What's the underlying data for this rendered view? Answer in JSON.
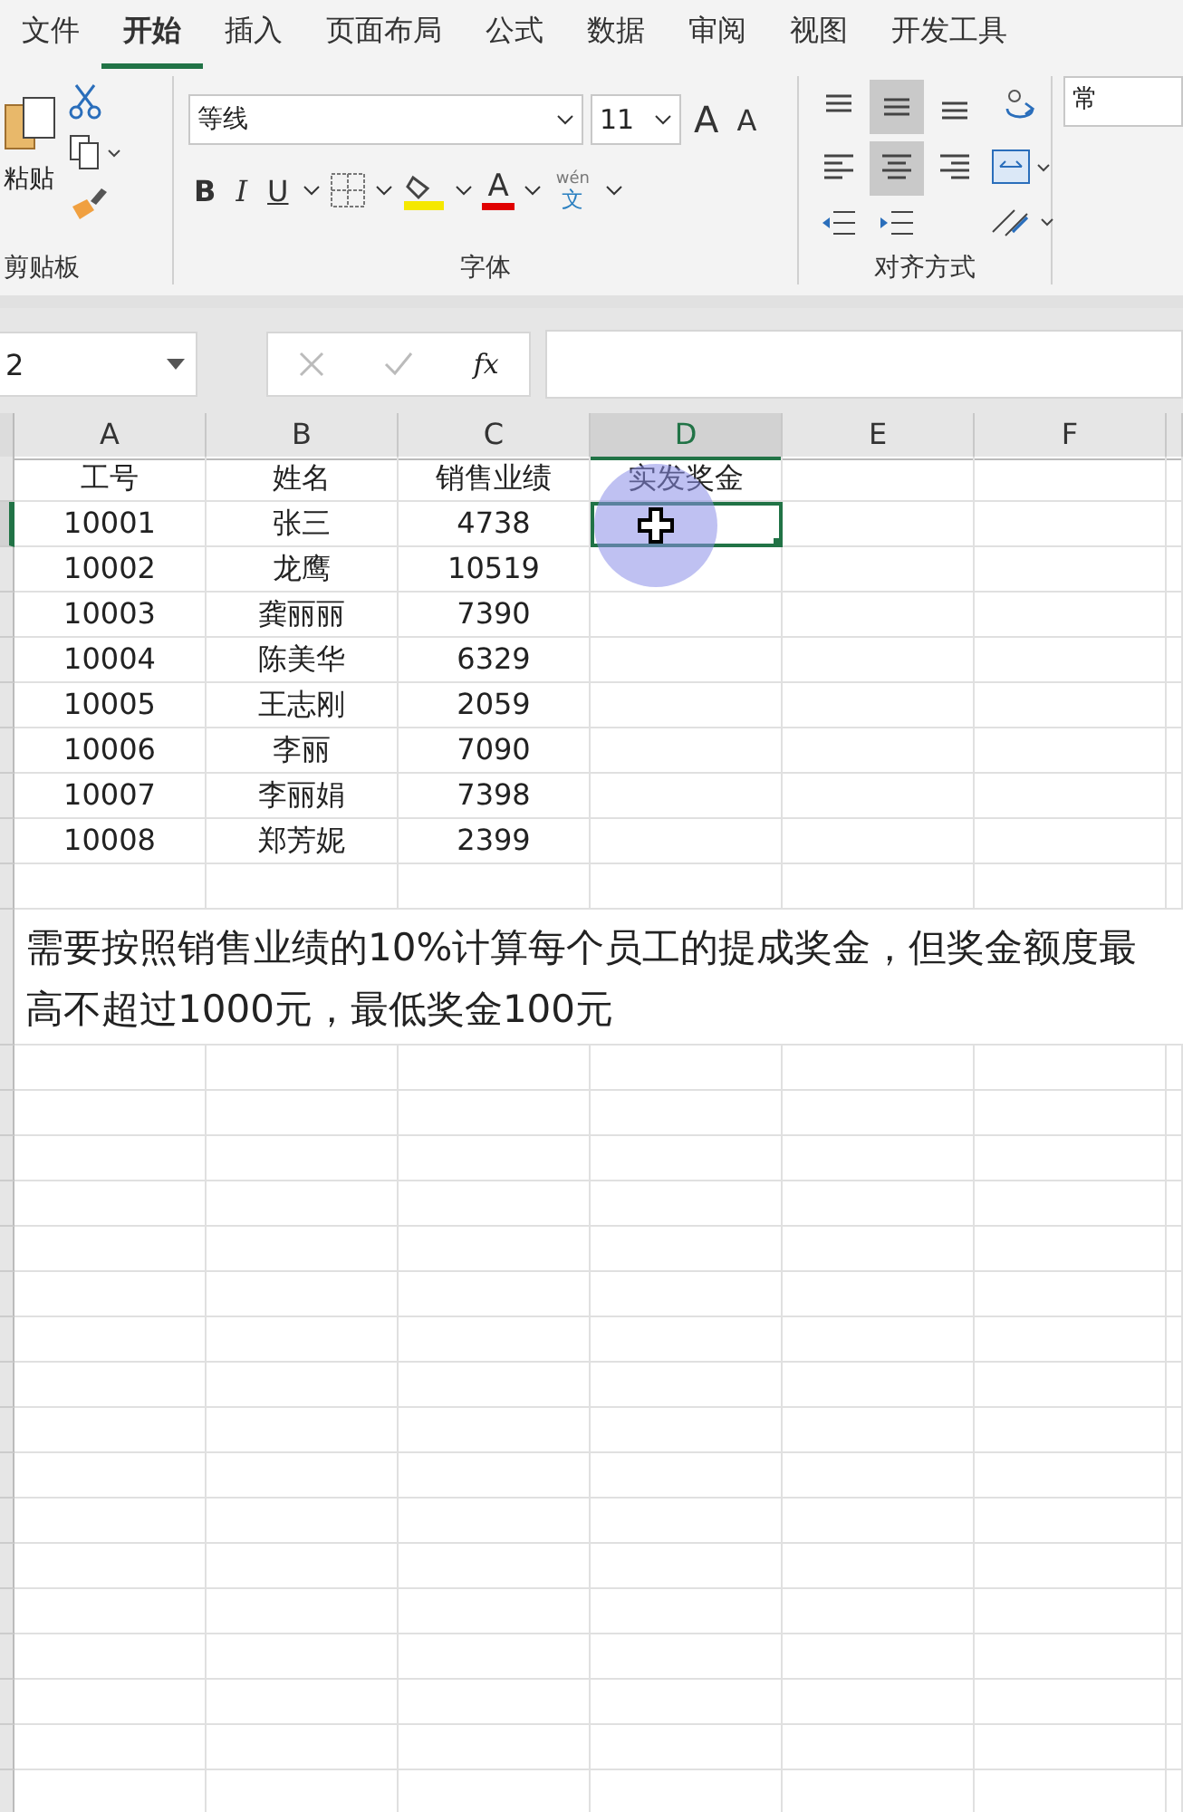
{
  "ribbon_tabs": [
    {
      "label": "文件",
      "selected": false
    },
    {
      "label": "开始",
      "selected": true
    },
    {
      "label": "插入",
      "selected": false
    },
    {
      "label": "页面布局",
      "selected": false
    },
    {
      "label": "公式",
      "selected": false
    },
    {
      "label": "数据",
      "selected": false
    },
    {
      "label": "审阅",
      "selected": false
    },
    {
      "label": "视图",
      "selected": false
    },
    {
      "label": "开发工具",
      "selected": false
    }
  ],
  "clipboard": {
    "paste_label": "粘贴",
    "group_label": "剪贴板"
  },
  "font": {
    "name": "等线",
    "size": "11",
    "grow": "A",
    "shrink": "A",
    "bold": "B",
    "italic": "I",
    "underline": "U",
    "font_color_letter": "A",
    "phonetic_top": "wén",
    "phonetic_bottom": "文",
    "group_label": "字体"
  },
  "alignment": {
    "group_label": "对齐方式",
    "vertical": [
      {
        "selected": false
      },
      {
        "selected": true
      },
      {
        "selected": false
      }
    ],
    "horizontal": [
      {
        "selected": false
      },
      {
        "selected": true
      },
      {
        "selected": false
      }
    ]
  },
  "number": {
    "format_partial": "常"
  },
  "formula_bar": {
    "name_box": "2",
    "fx": "fx"
  },
  "sheet": {
    "columns": [
      {
        "label": "A",
        "selected": false
      },
      {
        "label": "B",
        "selected": false
      },
      {
        "label": "C",
        "selected": false
      },
      {
        "label": "D",
        "selected": true
      },
      {
        "label": "E",
        "selected": false
      },
      {
        "label": "F",
        "selected": false
      }
    ],
    "rows": [
      {
        "cells": [
          "工号",
          "姓名",
          "销售业绩",
          "实发奖金"
        ],
        "selected": false
      },
      {
        "cells": [
          "10001",
          "张三",
          "4738"
        ],
        "selected": true
      },
      {
        "cells": [
          "10002",
          "龙鹰",
          "10519"
        ],
        "selected": false
      },
      {
        "cells": [
          "10003",
          "龚丽丽",
          "7390"
        ],
        "selected": false
      },
      {
        "cells": [
          "10004",
          "陈美华",
          "6329"
        ],
        "selected": false
      },
      {
        "cells": [
          "10005",
          "王志刚",
          "2059"
        ],
        "selected": false
      },
      {
        "cells": [
          "10006",
          "李丽",
          "7090"
        ],
        "selected": false
      },
      {
        "cells": [
          "10007",
          "李丽娟",
          "7398"
        ],
        "selected": false
      },
      {
        "cells": [
          "10008",
          "郑芳妮",
          "2399"
        ],
        "selected": false
      }
    ],
    "note": "需要按照销售业绩的10%计算每个员工的提成奖金，但奖金额度最高不超过1000元，最低奖金100元"
  }
}
